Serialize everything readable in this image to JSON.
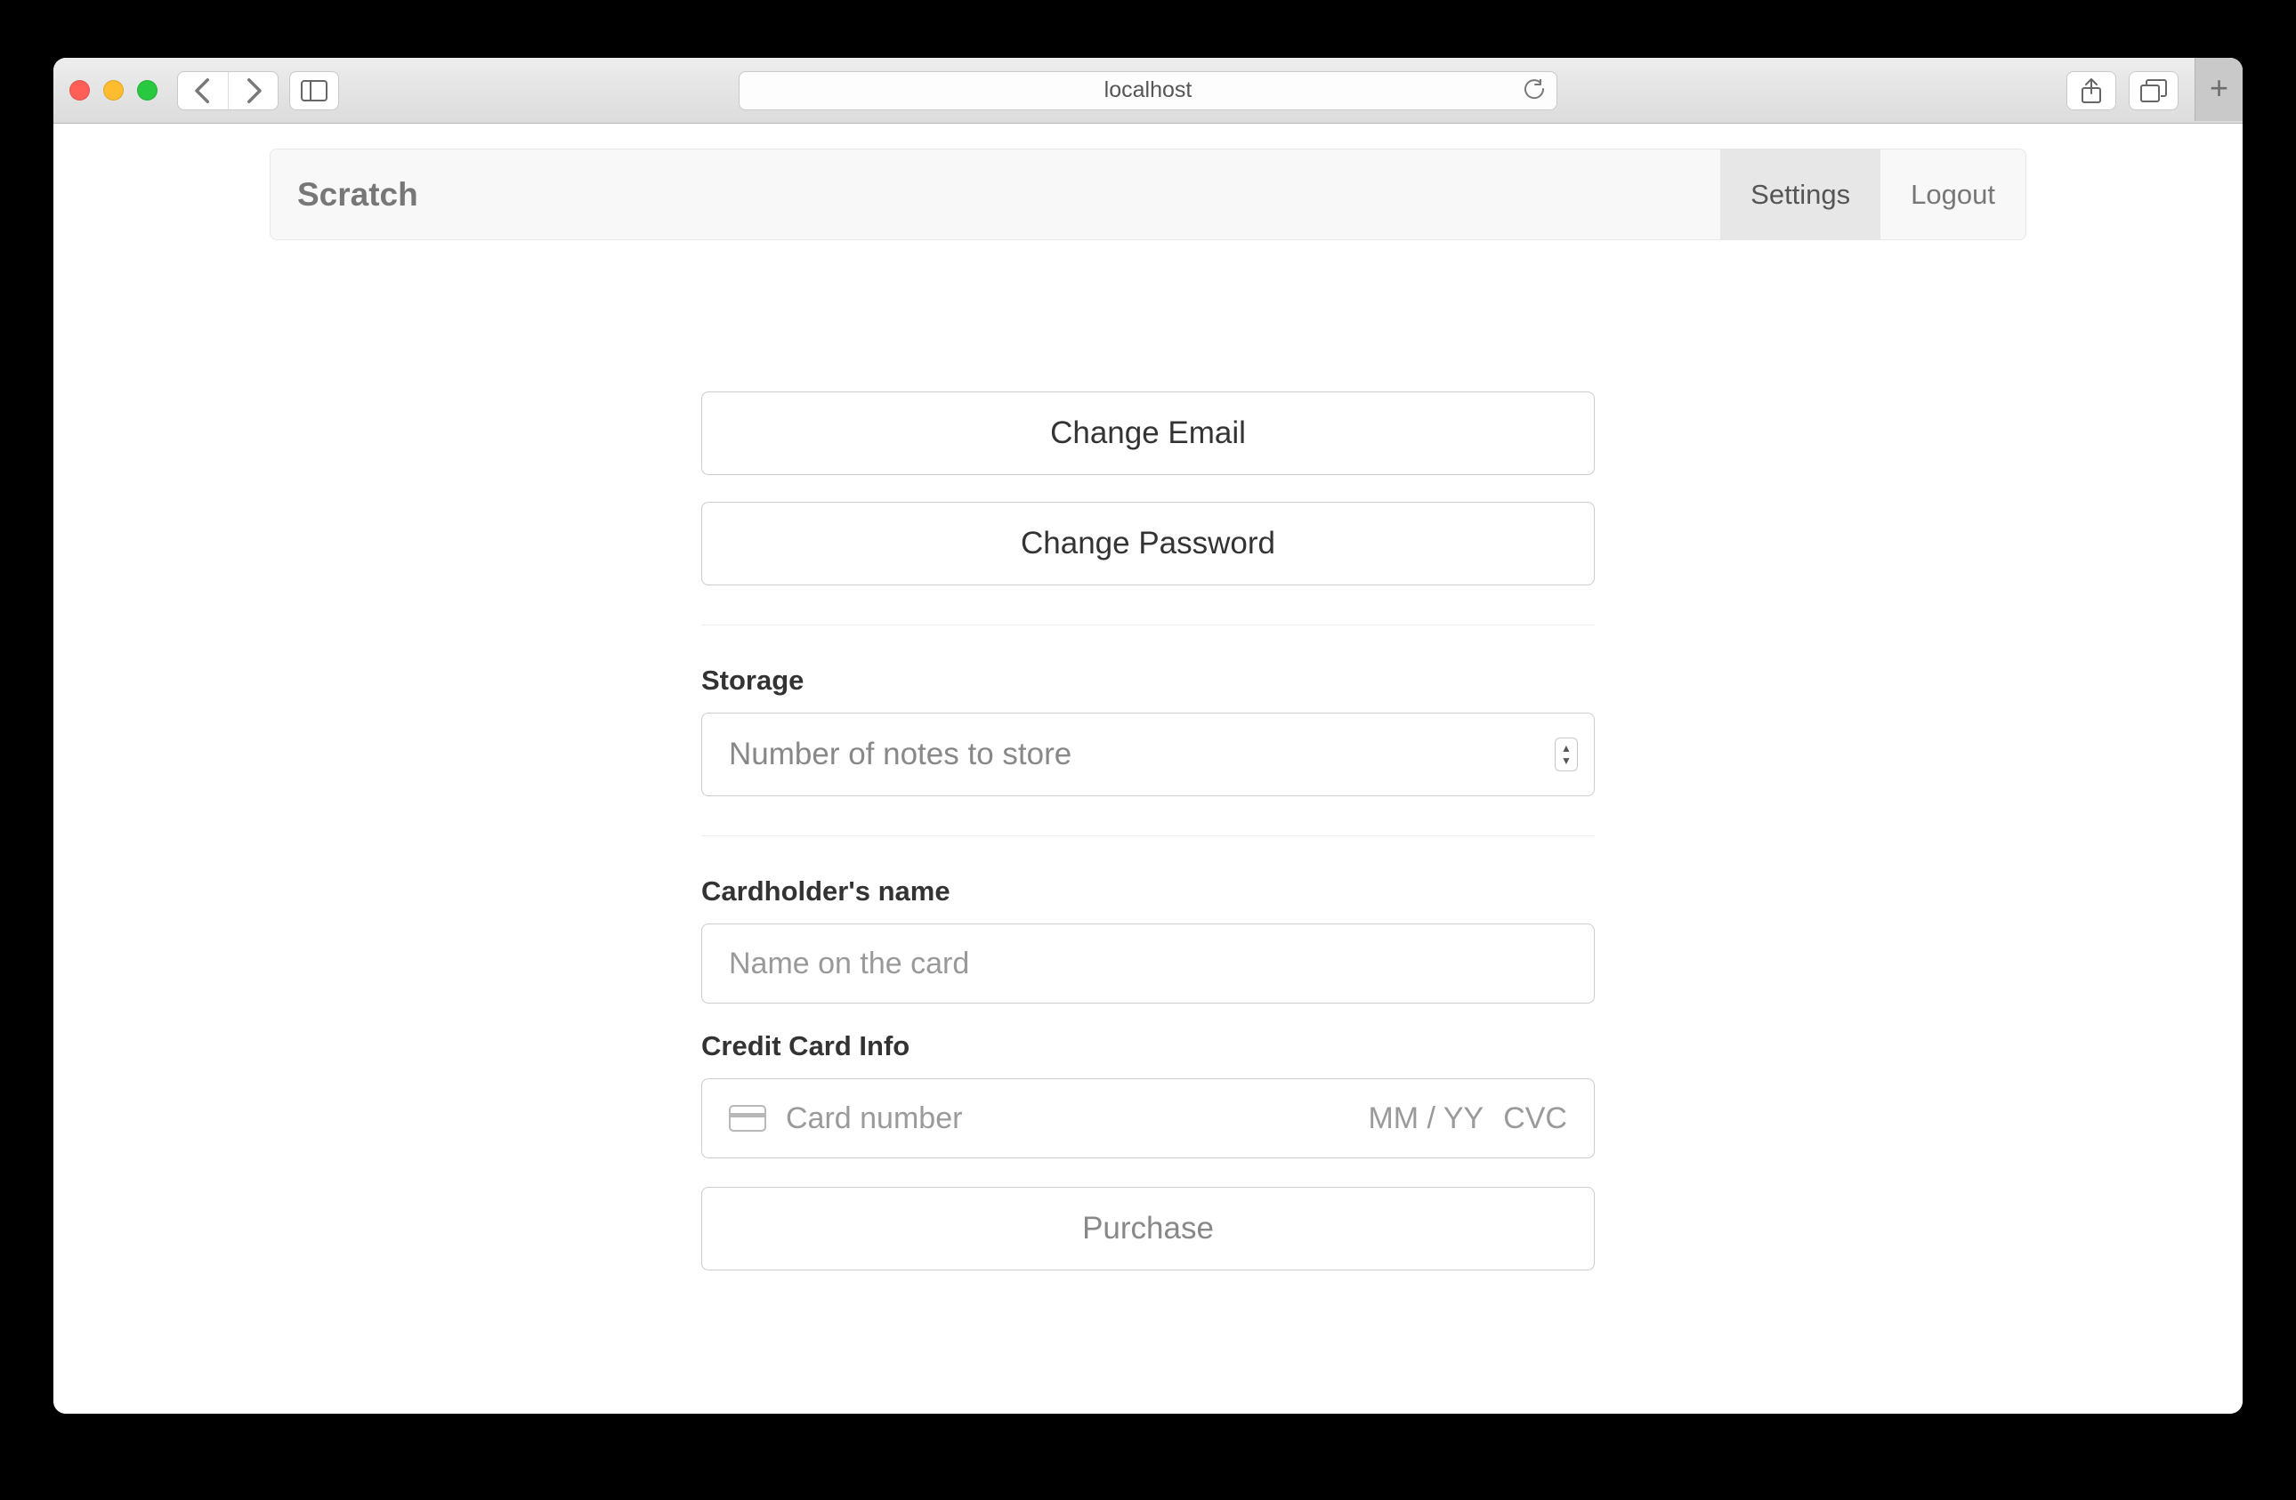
{
  "browser": {
    "url": "localhost"
  },
  "navbar": {
    "brand": "Scratch",
    "settings": "Settings",
    "logout": "Logout"
  },
  "buttons": {
    "change_email": "Change Email",
    "change_password": "Change Password",
    "purchase": "Purchase"
  },
  "labels": {
    "storage": "Storage",
    "cardholder": "Cardholder's name",
    "cc_info": "Credit Card Info"
  },
  "placeholders": {
    "storage_select": "Number of notes to store",
    "cardholder": "Name on the card",
    "card_number": "Card number",
    "expiry": "MM / YY",
    "cvc": "CVC"
  }
}
